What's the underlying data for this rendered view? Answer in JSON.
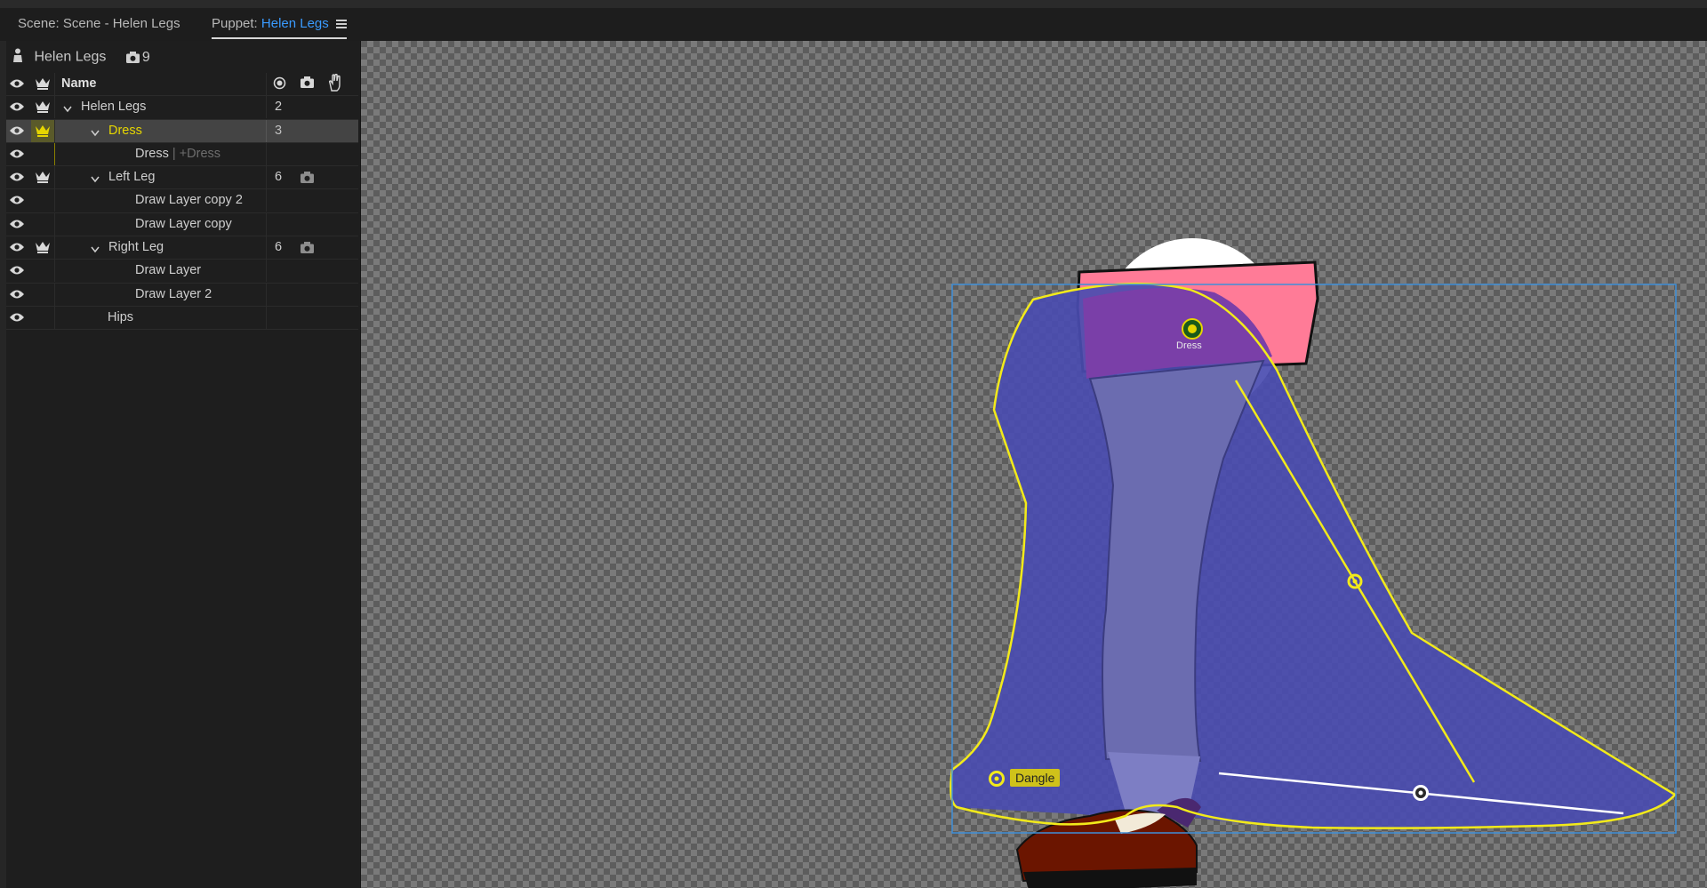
{
  "tabs": {
    "scene": "Scene: Scene - Helen Legs",
    "puppet_prefix": "Puppet: ",
    "puppet_name": "Helen Legs"
  },
  "panel": {
    "title": "Helen Legs",
    "count": "9",
    "header_name": "Name"
  },
  "rows": [
    {
      "label": "Helen Legs",
      "num": "2"
    },
    {
      "label": "Dress",
      "num": "3"
    },
    {
      "label": "Dress",
      "sub": "| +Dress"
    },
    {
      "label": "Left Leg",
      "num": "6"
    },
    {
      "label": "Draw Layer copy 2"
    },
    {
      "label": "Draw Layer copy"
    },
    {
      "label": "Right Leg",
      "num": "6"
    },
    {
      "label": "Draw Layer"
    },
    {
      "label": "Draw Layer 2"
    },
    {
      "label": "Hips"
    }
  ],
  "canvas": {
    "handle_dress": "Dress",
    "handle_dangle": "Dangle"
  },
  "colors": {
    "accent_blue": "#3a9bff",
    "selected_yellow": "#e6d600",
    "dress_fill": "#4a4cb0",
    "skirt_pink": "#ff7b97",
    "leg": "#6b6cb0",
    "shoe": "#6b1500"
  },
  "icons": [
    "eye-icon",
    "crown-icon",
    "person-icon",
    "camera-icon",
    "origin-icon",
    "hand-icon",
    "chevron-down-icon",
    "menu-icon"
  ]
}
